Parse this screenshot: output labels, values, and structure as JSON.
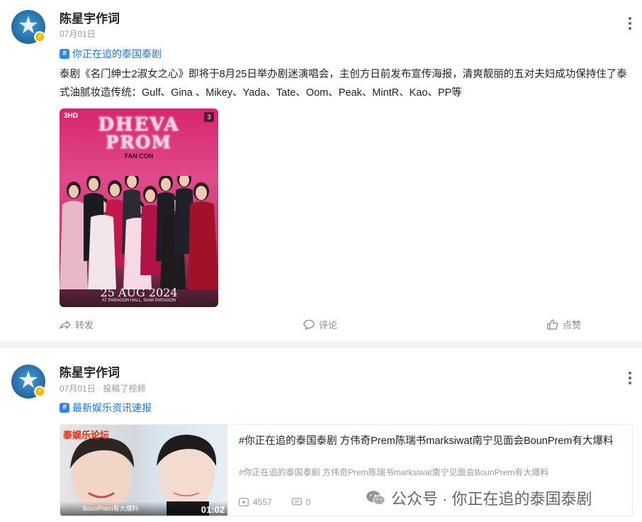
{
  "posts": [
    {
      "author": "陈星宇作词",
      "date": "07月01日",
      "topic": "你正在追的泰国泰剧",
      "content": "泰剧《名门绅士2淑女之心》即将于8月25日举办剧迷演唱会，主创方日前发布宣传海报，清爽靓丽的五对夫妇成功保持住了泰式油腻妆造传统：Gulf、Gina 、Mikey、Yada、Tate、Oom、Peak、MintR、Kao、PP等",
      "poster": {
        "channel": "3HD",
        "image_count": "3",
        "title_line1": "DHEVA",
        "title_line2": "PROM",
        "subtitle": "FAN CON",
        "date": "25 AUG 2024",
        "venue": "AT PARAGON HALL, SIAM PARAGON"
      },
      "actions": {
        "repost": "转发",
        "comment": "评论",
        "like": "点赞"
      }
    },
    {
      "author": "陈星宇作词",
      "meta": "07月01日 · 投稿了视频",
      "topic": "最新娱乐资讯速报",
      "video": {
        "brand": "泰娱乐论坛",
        "thumb_caption": "BounPrem有大爆料",
        "duration": "01:02",
        "title": "#你正在追的泰国泰剧 方伟奇Prem陈瑞书marksiwat南宁见面会BounPrem有大爆料",
        "subtitle": "#你正在追的泰国泰剧 方伟奇Prem陈瑞书marksiwat南宁见面会BounPrem有大爆料",
        "plays": "4557",
        "comments": "0"
      }
    }
  ],
  "watermark": {
    "text": "公众号 · 你正在追的泰国泰剧"
  },
  "colors": {
    "topic_blue": "#1a74d1",
    "badge_yellow": "#f5b800",
    "poster_pink": "#d8246f"
  }
}
